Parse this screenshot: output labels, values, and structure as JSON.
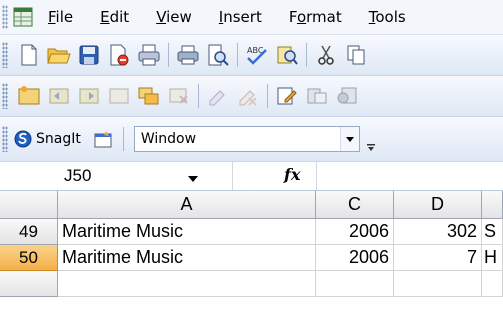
{
  "menu": {
    "items": [
      {
        "label": "File",
        "mnemonic": "F",
        "rest": "ile"
      },
      {
        "label": "Edit",
        "mnemonic": "E",
        "rest": "dit"
      },
      {
        "label": "View",
        "mnemonic": "V",
        "rest": "iew"
      },
      {
        "label": "Insert",
        "mnemonic": "I",
        "rest": "nsert"
      },
      {
        "label": "Format",
        "pre": "F",
        "mnemonic": "o",
        "rest": "rmat"
      },
      {
        "label": "Tools",
        "mnemonic": "T",
        "rest": "ools"
      }
    ]
  },
  "snagit_toolbar": {
    "snagit_label": "SnagIt",
    "window_value": "Window"
  },
  "formula_bar": {
    "name_box": "J50",
    "fx_label": "fx",
    "formula": ""
  },
  "grid": {
    "columns": [
      "A",
      "C",
      "D",
      ""
    ],
    "rows": [
      {
        "row": "49",
        "A": "Maritime Music",
        "C": "2006",
        "D": "302",
        "E": "S",
        "selected": false
      },
      {
        "row": "50",
        "A": "Maritime Music",
        "C": "2006",
        "D": "7",
        "E": "H",
        "selected": true
      }
    ]
  },
  "colors": {
    "selected_row_header": "#f4b04a",
    "toolbar_gradient_top": "#f7f9fd",
    "toolbar_gradient_bottom": "#dfe8f5"
  }
}
